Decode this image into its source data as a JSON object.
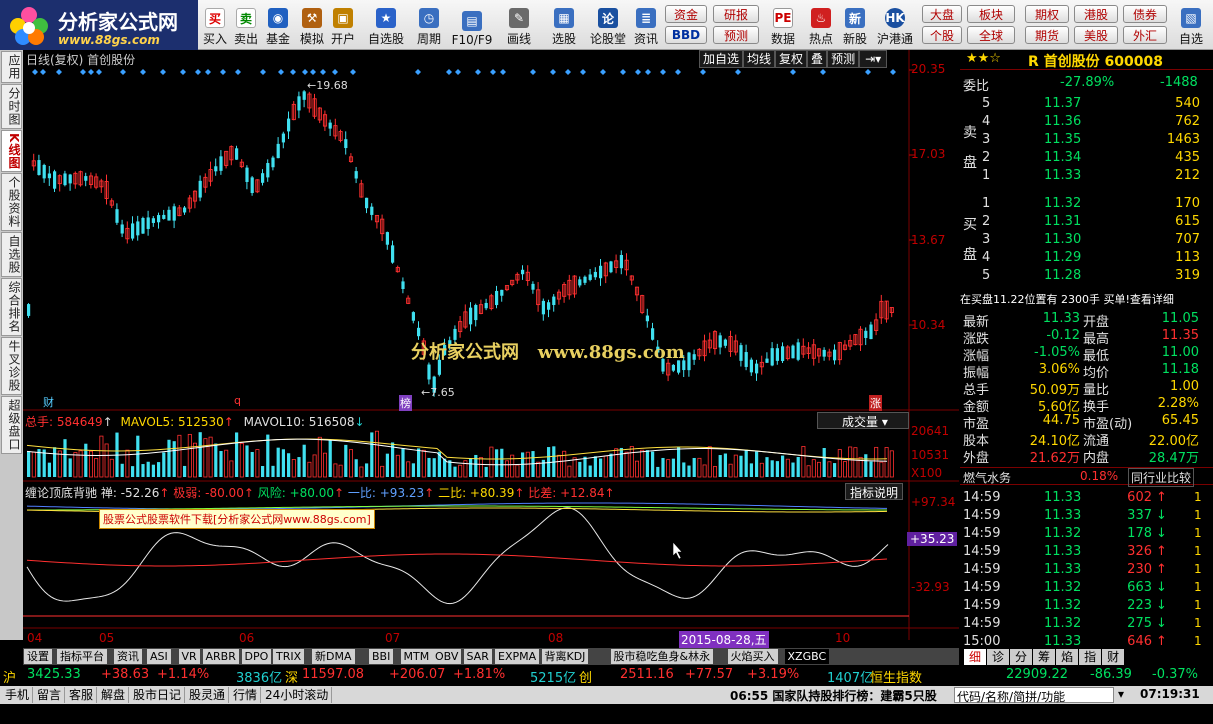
{
  "logo": {
    "title": "分析家公式网",
    "url": "www.88gs.com"
  },
  "toolbar": {
    "buy": "买入",
    "sell": "卖出",
    "fund": "基金",
    "sim": "模拟",
    "open": "开户",
    "watch": "自选股",
    "period": "周期",
    "f10": "F10/F9",
    "draw": "画线",
    "pick": "选股",
    "forum": "论股堂",
    "news": "资讯",
    "data": "数据",
    "hot": "热点",
    "newstock": "新股",
    "hk": "沪港通",
    "zijin": "资金",
    "yanbao": "研报",
    "bbd": "BBD",
    "yuce": "预测",
    "dapan": "大盘",
    "bankuai": "板块",
    "geguo": "个股",
    "quanqiu": "全球",
    "qihuo": "期权",
    "qihuo2": "期货",
    "ganggu": "港股",
    "meigu": "美股",
    "zhaiquan": "债券",
    "waihui": "外汇",
    "zixuan": "自选"
  },
  "lefttabs": [
    "应用",
    "分时图",
    "K线图",
    "个股资料",
    "自选股",
    "综合排名",
    "牛叉诊股",
    "超级盘口"
  ],
  "chart": {
    "title": "日线(复权) 首创股份",
    "btns": [
      "加自选",
      "均线",
      "复权",
      "叠",
      "预测"
    ],
    "price_labels": [
      "20.35",
      "17.03",
      "13.67",
      "10.34"
    ],
    "high_label": "19.68",
    "low_label": "7.65",
    "watermark": "分析家公式网   www.88gs.com",
    "markers": [
      "财",
      "q",
      "榜",
      "涨"
    ]
  },
  "volume": {
    "total": "总手: 584649",
    "mavol5": "MAVOL5: 512530",
    "mavol10": "MAVOL10: 516508",
    "name": "成交量",
    "labels": [
      "20641",
      "10531",
      "X100"
    ]
  },
  "indicator": {
    "name": "缠论顶底背驰",
    "chan": "禅: -52.26",
    "jiruo": "极弱: -80.00",
    "fengxian": "风险: +80.00",
    "yibi": "一比: +93.23",
    "erbi": "二比: +80.39",
    "bicha": "比差: +12.84",
    "btn": "指标说明",
    "ad": "股票公式股票软件下载[分析家公式网www.88gs.com]",
    "labels": [
      "+97.34",
      "+35.23",
      "-32.93"
    ]
  },
  "xaxis": {
    "ticks": [
      "04",
      "05",
      "06",
      "07",
      "08",
      "10"
    ],
    "cursor_date": "2015-08-28,五"
  },
  "bottomtabs": [
    "设置",
    "指标平台",
    "资讯",
    "ASI",
    "VR",
    "ARBR",
    "DPO",
    "TRIX",
    "新DMA",
    "BBI",
    "MTM",
    "OBV",
    "SAR",
    "EXPMA",
    "背离KDJ",
    "股市稳吃鱼身&林永",
    "火焰买入",
    "XZGBC"
  ],
  "stock": {
    "stars": "★★☆",
    "code": "R 首创股份 600008",
    "weibi_label": "委比",
    "weibi": "-27.89%",
    "weicha": "-1488",
    "sell_label": "卖盘",
    "buy_label": "买盘",
    "sells": [
      {
        "n": "5",
        "p": "11.37",
        "v": "540"
      },
      {
        "n": "4",
        "p": "11.36",
        "v": "762"
      },
      {
        "n": "3",
        "p": "11.35",
        "v": "1463"
      },
      {
        "n": "2",
        "p": "11.34",
        "v": "435"
      },
      {
        "n": "1",
        "p": "11.33",
        "v": "212"
      }
    ],
    "buys": [
      {
        "n": "1",
        "p": "11.32",
        "v": "170"
      },
      {
        "n": "2",
        "p": "11.31",
        "v": "615"
      },
      {
        "n": "3",
        "p": "11.30",
        "v": "707"
      },
      {
        "n": "4",
        "p": "11.29",
        "v": "113"
      },
      {
        "n": "5",
        "p": "11.28",
        "v": "319"
      }
    ],
    "note": "在买盘11.22位置有 2300手 买单!查看详细",
    "stats": [
      [
        "最新",
        "11.33",
        "开盘",
        "11.05"
      ],
      [
        "涨跌",
        "-0.12",
        "最高",
        "11.35"
      ],
      [
        "涨幅",
        "-1.05%",
        "最低",
        "11.00"
      ],
      [
        "振幅",
        "3.06%",
        "均价",
        "11.18"
      ],
      [
        "总手",
        "50.09万",
        "量比",
        "1.00"
      ],
      [
        "金额",
        "5.60亿",
        "换手",
        "2.28%"
      ],
      [
        "市盈",
        "44.75",
        "市盈(动)",
        "65.45"
      ],
      [
        "股本",
        "24.10亿",
        "流通",
        "22.00亿"
      ],
      [
        "外盘",
        "21.62万",
        "内盘",
        "28.47万"
      ]
    ],
    "industry": "燃气水务",
    "industry_pct": "0.18%",
    "compare": "同行业比较",
    "ticks": [
      [
        "14:59",
        "11.33",
        "602",
        "↑"
      ],
      [
        "14:59",
        "11.33",
        "337",
        "↓"
      ],
      [
        "14:59",
        "11.32",
        "178",
        "↓"
      ],
      [
        "14:59",
        "11.33",
        "326",
        "↑"
      ],
      [
        "14:59",
        "11.33",
        "230",
        "↑"
      ],
      [
        "14:59",
        "11.32",
        "663",
        "↓"
      ],
      [
        "14:59",
        "11.32",
        "223",
        "↓"
      ],
      [
        "14:59",
        "11.32",
        "275",
        "↓"
      ],
      [
        "15:00",
        "11.33",
        "646",
        "↑"
      ]
    ],
    "rtabs": [
      "细",
      "诊",
      "分",
      "筹",
      "焰",
      "指",
      "财"
    ]
  },
  "index": {
    "sh": "沪",
    "sh_v": "3425.33",
    "sh_c": "+38.63",
    "sh_p": "+1.14%",
    "sh_a": "3836亿",
    "sz": "深",
    "sz_v": "11597.08",
    "sz_c": "+206.07",
    "sz_p": "+1.81%",
    "sz_a": "5215亿",
    "cy": "创",
    "cy_v": "2511.16",
    "cy_c": "+77.57",
    "cy_p": "+3.19%",
    "cy_a": "1407亿",
    "hs": "恒生指数",
    "hs_v": "22909.22",
    "hs_c": "-86.39",
    "hs_p": "-0.37%"
  },
  "status": {
    "items": [
      "手机",
      "留言",
      "客服",
      "解盘",
      "股市日记",
      "股灵通",
      "行情",
      "24小时滚动"
    ],
    "ticker": "06:55 国家队持股排行榜：建霸5只股",
    "search": "代码/名称/简拼/功能",
    "time": "07:19:31"
  }
}
